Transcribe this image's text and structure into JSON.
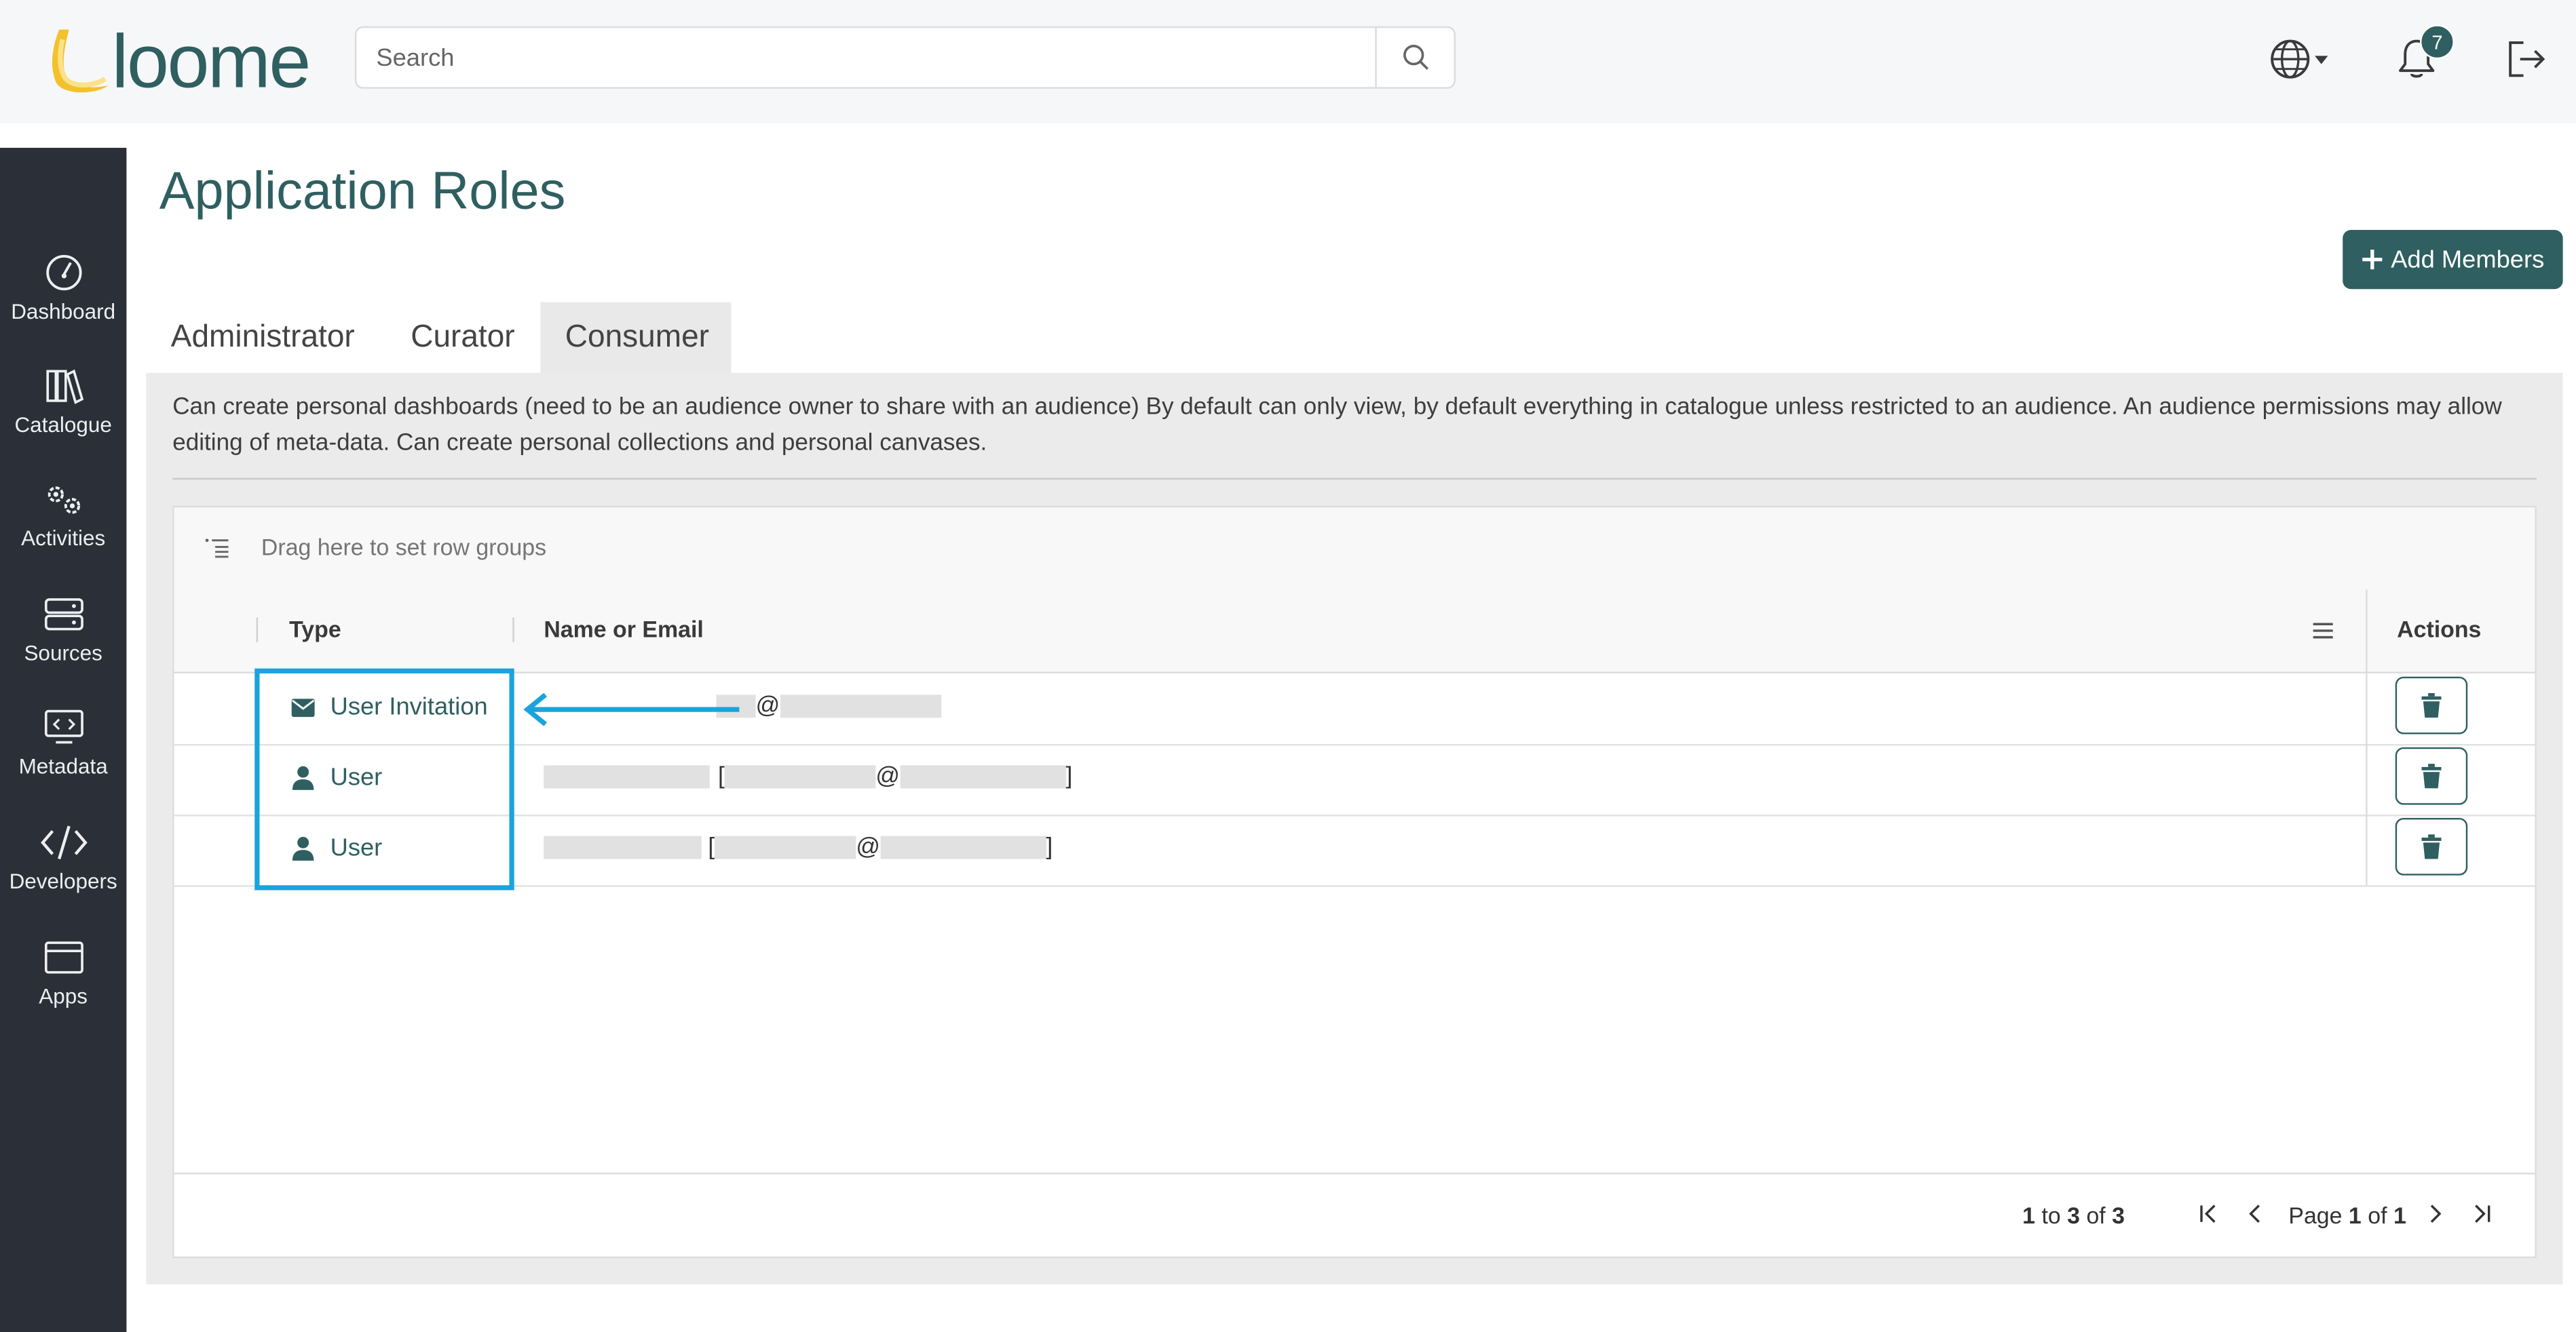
{
  "brand": {
    "logo_text": "loome"
  },
  "search": {
    "placeholder": "Search"
  },
  "header": {
    "notification_count": "7"
  },
  "sidebar": {
    "items": [
      {
        "label": "Dashboard"
      },
      {
        "label": "Catalogue"
      },
      {
        "label": "Activities"
      },
      {
        "label": "Sources"
      },
      {
        "label": "Metadata"
      },
      {
        "label": "Developers"
      },
      {
        "label": "Apps"
      }
    ]
  },
  "page": {
    "title": "Application Roles",
    "add_button": "Add Members"
  },
  "tabs": [
    {
      "label": "Administrator",
      "active": false
    },
    {
      "label": "Curator",
      "active": false
    },
    {
      "label": "Consumer",
      "active": true
    }
  ],
  "role_description": "Can create personal dashboards (need to be an audience owner to share with an audience) By default can only view, by default everything in catalogue unless restricted to an audience. An audience permissions may allow editing of meta-data. Can create personal collections and personal canvases.",
  "grid": {
    "group_hint": "Drag here to set row groups",
    "columns": {
      "type": "Type",
      "name": "Name or Email",
      "actions": "Actions"
    },
    "rows": [
      {
        "type": "User Invitation",
        "icon": "envelope-icon",
        "name_parts": [
          "@"
        ]
      },
      {
        "type": "User",
        "icon": "person-icon",
        "name_parts": [
          "[",
          "@",
          "]"
        ]
      },
      {
        "type": "User",
        "icon": "person-icon",
        "name_parts": [
          "[",
          "@",
          "]"
        ]
      }
    ],
    "pagination": {
      "from": "1",
      "to_word": "to",
      "to": "3",
      "of_word": "of",
      "total": "3",
      "page_word": "Page",
      "page": "1",
      "page_of_word": "of",
      "pages": "1"
    }
  },
  "colors": {
    "brand": "#2f5f60",
    "sidebar_bg": "#2b2f38",
    "highlight": "#19a4dd"
  }
}
